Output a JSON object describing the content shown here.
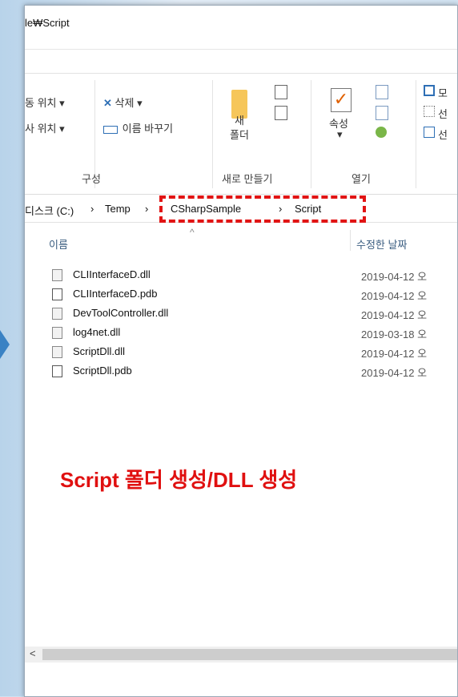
{
  "window": {
    "title": "le₩Script"
  },
  "ribbon": {
    "move_to": "동 위치 ▾",
    "copy_to": "사 위치 ▾",
    "delete": "삭제 ▾",
    "rename": "이름 바꾸기",
    "new_folder_line1": "새",
    "new_folder_line2": "폴더",
    "properties": "속성",
    "properties_arrow": "▾",
    "group_organize": "구성",
    "group_new": "새로 만들기",
    "group_open": "열기",
    "select_1": "모",
    "select_2": "선",
    "select_3": "선"
  },
  "address": {
    "crumbs": [
      "디스크 (C:)",
      "›",
      "Temp",
      "›",
      "CSharpSample",
      "›",
      "Script"
    ]
  },
  "list": {
    "col_name": "이름",
    "col_date": "수정한 날짜",
    "files": [
      {
        "name": "CLIInterfaceD.dll",
        "date": "2019-04-12 오",
        "type": "dll"
      },
      {
        "name": "CLIInterfaceD.pdb",
        "date": "2019-04-12 오",
        "type": "pdb"
      },
      {
        "name": "DevToolController.dll",
        "date": "2019-04-12 오",
        "type": "dll"
      },
      {
        "name": "log4net.dll",
        "date": "2019-03-18 오",
        "type": "dll"
      },
      {
        "name": "ScriptDll.dll",
        "date": "2019-04-12 오",
        "type": "dll"
      },
      {
        "name": "ScriptDll.pdb",
        "date": "2019-04-12 오",
        "type": "pdb"
      }
    ]
  },
  "annotation": "Script 폴더 생성/DLL 생성",
  "scroll": {
    "left_arrow": "<"
  },
  "colors": {
    "highlight": "#e11414",
    "annotation": "#e01010",
    "accent": "#3a82c4"
  }
}
